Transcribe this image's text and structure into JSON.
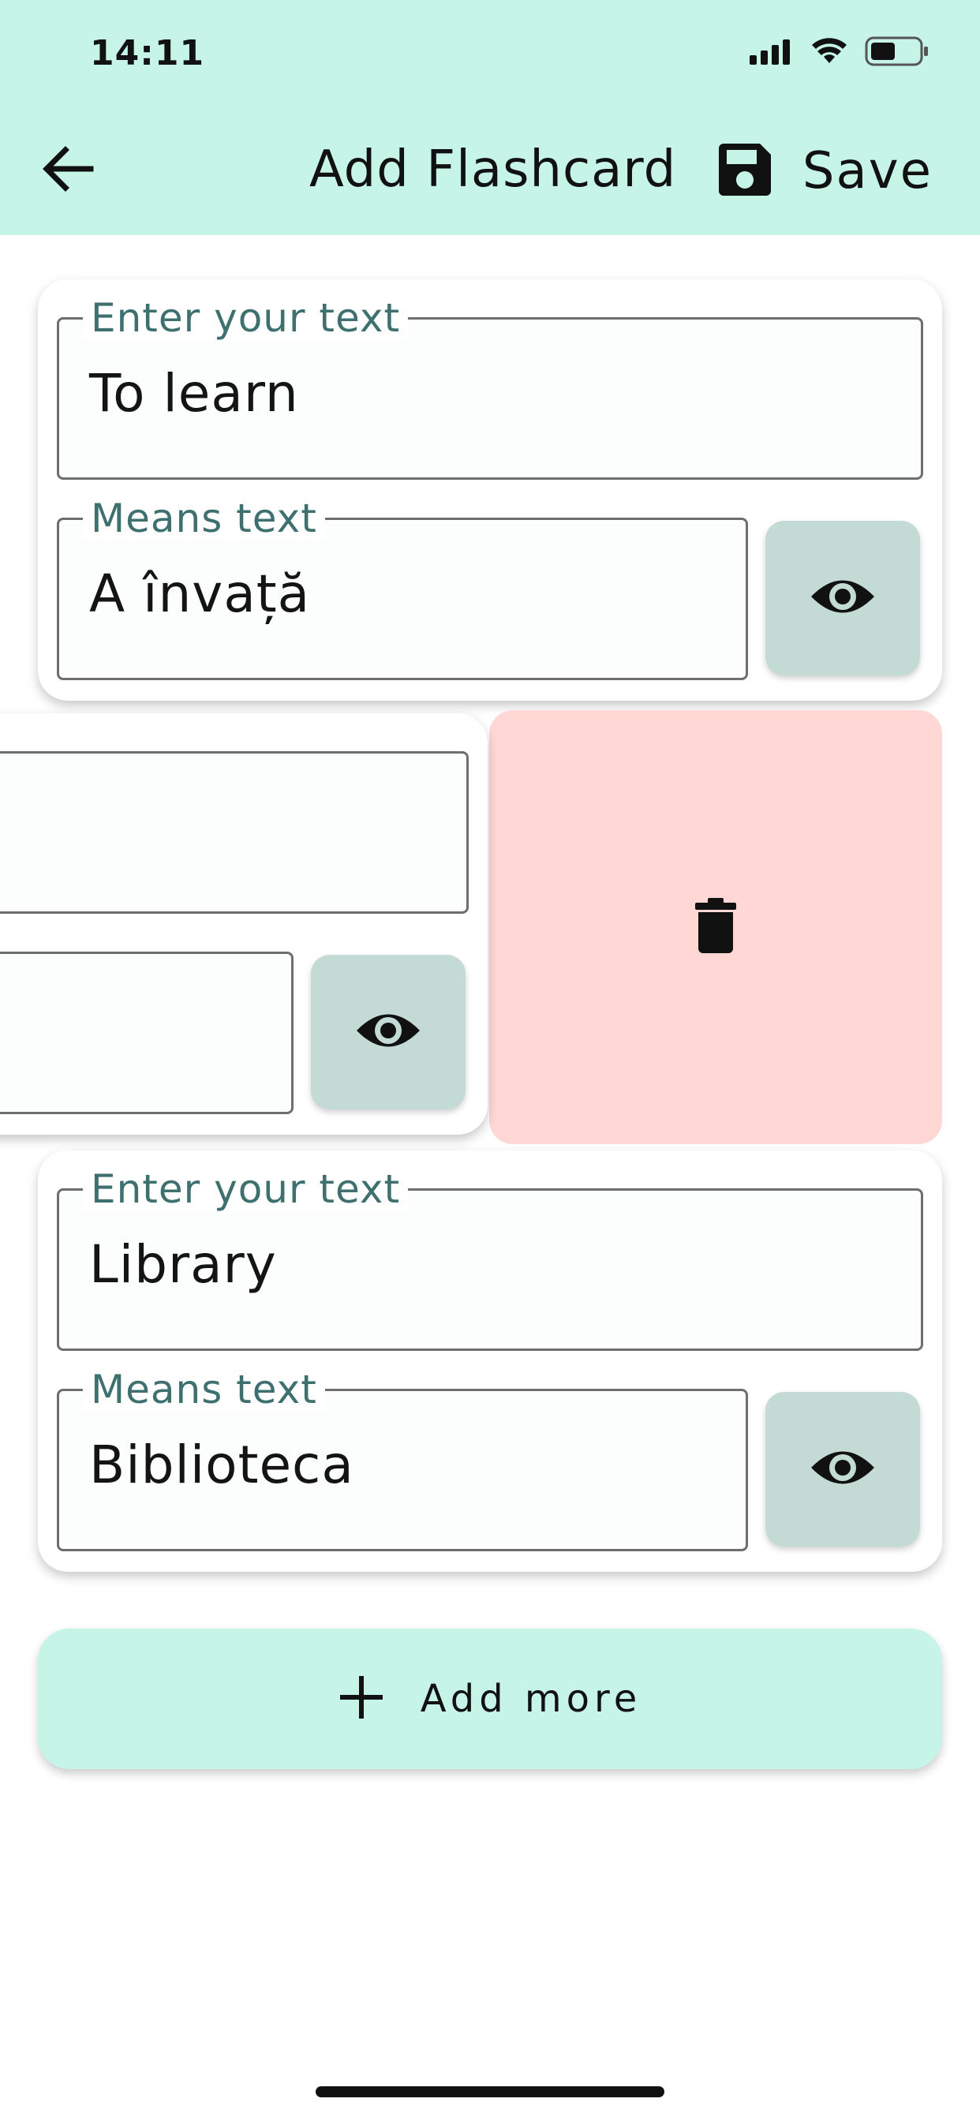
{
  "status_bar": {
    "time": "14:11",
    "icons": [
      "signal-icon",
      "wifi-icon",
      "battery-icon"
    ]
  },
  "header": {
    "title": "Add Flashcard",
    "save_label": "Save",
    "back_icon": "arrow-left-icon",
    "save_icon": "floppy-disk-icon"
  },
  "cards": [
    {
      "term_label": "Enter your text",
      "term_value": "To learn",
      "meaning_label": "Means text",
      "meaning_value": "A învață"
    },
    {
      "term_label": "",
      "term_value": "",
      "meaning_label": "",
      "meaning_value": ""
    },
    {
      "term_label": "Enter your text",
      "term_value": "Library",
      "meaning_label": "Means text",
      "meaning_value": "Biblioteca"
    }
  ],
  "add_more": {
    "label": "Add more",
    "icon": "plus-icon"
  },
  "colors": {
    "header_bg": "#c6f5e8",
    "delete_bg": "#ffd8d6",
    "eye_button_bg": "#c4dbd5",
    "label_color": "#3f7070"
  }
}
